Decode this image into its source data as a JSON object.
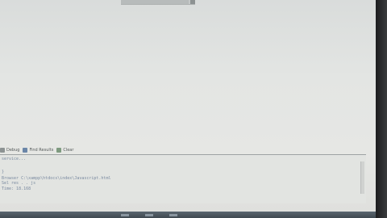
{
  "toolbar": {
    "debug_label": "Debug",
    "find_results_label": "Find Results",
    "clear_label": "Clear"
  },
  "editor": {
    "status_line": "service..."
  },
  "console": {
    "lines": [
      "}",
      "Browser C:\\xampp\\htdocs\\index\\Javascript.html",
      "Sel     res   .    .  js",
      "     Time: 18.168"
    ]
  }
}
